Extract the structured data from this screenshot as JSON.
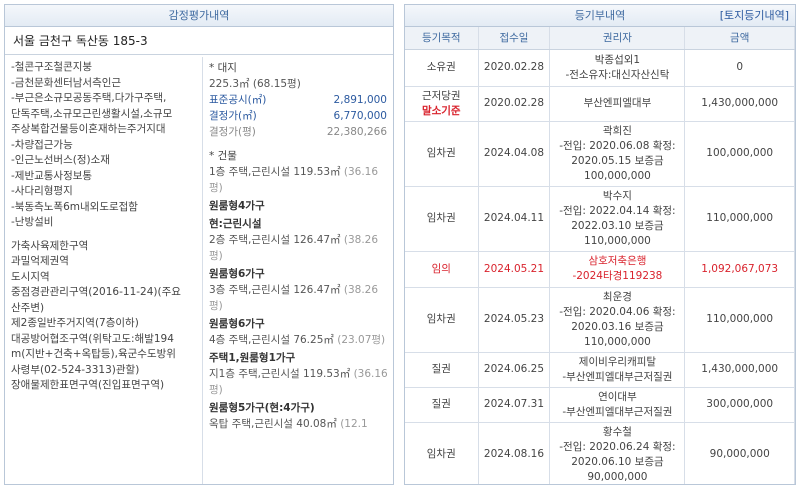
{
  "left": {
    "header": "감정평가내역",
    "address": "서울 금천구 독산동 185-3",
    "features": [
      "-철콘구조철콘지붕",
      "-금천문화센터남서측인근",
      "-부근은소규모공동주택,다가구주택,",
      "단독주택,소규모근린생활시설,소규모",
      "주상복합건물등이혼재하는주거지대",
      "-차량접근가능",
      "-인근노선버스(정)소재",
      "-제반교통사정보통",
      "-사다리형평지",
      "-북동측노폭6m내외도로접함",
      "-난방설비"
    ],
    "zones": [
      "가축사육제한구역",
      "과밀억제권역",
      "도시지역",
      "중점경관관리구역(2016-11-24)(주요",
      "산주변)",
      "제2종일반주거지역(7층이하)",
      "대공방어협조구역(위탁고도:해발194",
      "m(지반+건축+옥탑등),육군수도방위",
      "사령부(02-524-3313)관할)",
      "장애물제한표면구역(진입표면구역)"
    ],
    "land_title": "* 대지",
    "land_area": "225.3㎡ (68.15평)",
    "price_rows": [
      {
        "k": "표준공시(㎡)",
        "v": "2,891,000"
      },
      {
        "k": "결정가(㎡)",
        "v": "6,770,000"
      },
      {
        "k": "결정가(평)",
        "v": "22,380,266"
      }
    ],
    "bldg_title": "* 건물",
    "buildings": [
      {
        "line": "1층 주택,근린시설 119.53㎡ ",
        "extra": "(36.16평)"
      },
      {
        "bold": "원룸형4가구"
      },
      {
        "bold": "현:근린시설"
      },
      {
        "line": "2층 주택,근린시설 126.47㎡ ",
        "extra": "(38.26평)"
      },
      {
        "bold": "원룸형6가구"
      },
      {
        "line": "3층 주택,근린시설 126.47㎡ ",
        "extra": "(38.26평)"
      },
      {
        "bold": "원룸형6가구"
      },
      {
        "line": "4층 주택,근린시설 76.25㎡ ",
        "extra": "(23.07평)"
      },
      {
        "bold": "주택1,원룸형1가구"
      },
      {
        "line": "지1층 주택,근린시설 119.53㎡ ",
        "extra": "(36.16평)"
      },
      {
        "bold": "원룸형5가구(현:4가구)"
      },
      {
        "line": "옥탑 주택,근린시설 40.08㎡ ",
        "extra": "(12.1"
      }
    ]
  },
  "right": {
    "header": "등기부내역",
    "link": "[토지등기내역]",
    "columns": [
      "등기목적",
      "접수일",
      "권리자",
      "금액"
    ],
    "rows": [
      {
        "purpose": "소유권",
        "date": "2020.02.28",
        "holder": [
          "박종섭외1",
          "-전소유자:대신자산신탁"
        ],
        "amount": "0"
      },
      {
        "purpose": "근저당권",
        "purpose2": "말소기준",
        "date": "2020.02.28",
        "holder": [
          "부산엔피엘대부"
        ],
        "amount": "1,430,000,000"
      },
      {
        "purpose": "임차권",
        "date": "2024.04.08",
        "holder": [
          "곽희진",
          "-전입: 2020.06.08 확정:",
          "2020.05.15 보증금",
          "100,000,000"
        ],
        "amount": "100,000,000"
      },
      {
        "purpose": "임차권",
        "date": "2024.04.11",
        "holder": [
          "박수지",
          "-전입: 2022.04.14 확정:",
          "2022.03.10 보증금",
          "110,000,000"
        ],
        "amount": "110,000,000"
      },
      {
        "purpose": "임의",
        "date": "2024.05.21",
        "holder": [
          "삼호저축은행",
          "-2024타경119238"
        ],
        "amount": "1,092,067,073",
        "highlight": true
      },
      {
        "purpose": "임차권",
        "date": "2024.05.23",
        "holder": [
          "최운경",
          "-전입: 2020.04.06 확정:",
          "2020.03.16 보증금",
          "110,000,000"
        ],
        "amount": "110,000,000"
      },
      {
        "purpose": "질권",
        "date": "2024.06.25",
        "holder": [
          "제이비우리캐피탈",
          "-부산엔피엘대부근저질권"
        ],
        "amount": "1,430,000,000"
      },
      {
        "purpose": "질권",
        "date": "2024.07.31",
        "holder": [
          "연이대부",
          "-부산엔피엘대부근저질권"
        ],
        "amount": "300,000,000"
      },
      {
        "purpose": "임차권",
        "date": "2024.08.16",
        "holder": [
          "황수철",
          "-전입: 2020.06.24 확정:",
          "2020.06.10 보증금",
          "90,000,000"
        ],
        "amount": "90,000,000"
      }
    ]
  },
  "colors": {
    "accent": "#3f6aa0",
    "highlight": "#d9232d",
    "border": "#b9c7d8"
  }
}
